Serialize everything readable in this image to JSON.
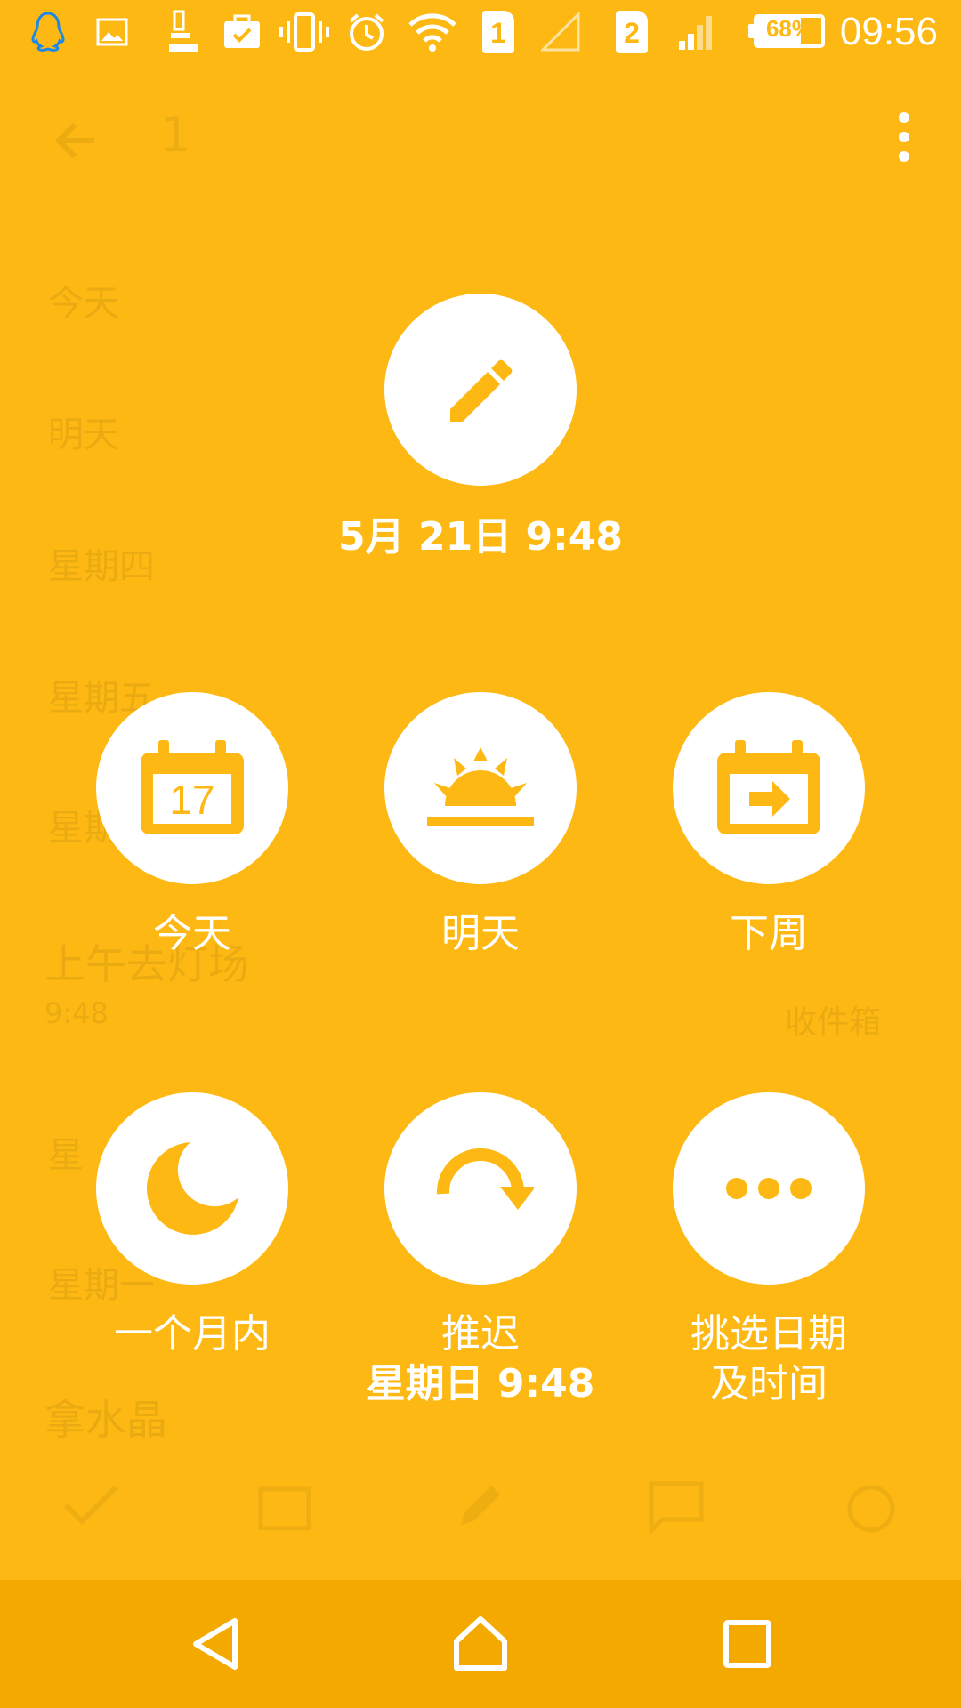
{
  "status_bar": {
    "time": "09:56",
    "battery_percent": "68%",
    "sim1": "1",
    "sim2": "2",
    "icons": [
      "qq-icon",
      "image-icon",
      "data-speed-icon",
      "briefcase-check-icon",
      "vibrate-icon",
      "alarm-icon",
      "wifi-icon",
      "sim1-icon",
      "signal-empty-icon",
      "sim2-icon",
      "signal-icon",
      "battery-icon"
    ]
  },
  "app_bar": {
    "title": "1"
  },
  "background_list": {
    "rows": [
      "今天",
      "明天",
      "星期四",
      "星期五",
      "星期",
      "上午去灯场",
      "9:48",
      "收件箱",
      "星",
      "星期一",
      "拿水晶"
    ]
  },
  "snooze": {
    "current": {
      "label": "5月 21日 9:48",
      "icon": "pencil-icon"
    },
    "options": [
      {
        "id": "today",
        "label": "今天",
        "icon": "calendar-17-icon",
        "icon_text": "17"
      },
      {
        "id": "tomorrow",
        "label": "明天",
        "icon": "sunrise-icon"
      },
      {
        "id": "next-week",
        "label": "下周",
        "icon": "calendar-arrow-icon"
      },
      {
        "id": "within-month",
        "label": "一个月内",
        "icon": "moon-icon"
      },
      {
        "id": "postpone",
        "label": "推迟",
        "sublabel": "星期日 9:48",
        "icon": "redo-arrow-icon"
      },
      {
        "id": "pick-date",
        "label": "挑选日期",
        "sublabel": "及时间",
        "icon": "more-dots-icon"
      }
    ]
  },
  "colors": {
    "background": "#FDB813",
    "navbar": "#F4A900",
    "circle": "#FFFFFF"
  },
  "nav_bar": {
    "buttons": [
      "back-icon",
      "home-icon",
      "recents-icon"
    ]
  }
}
